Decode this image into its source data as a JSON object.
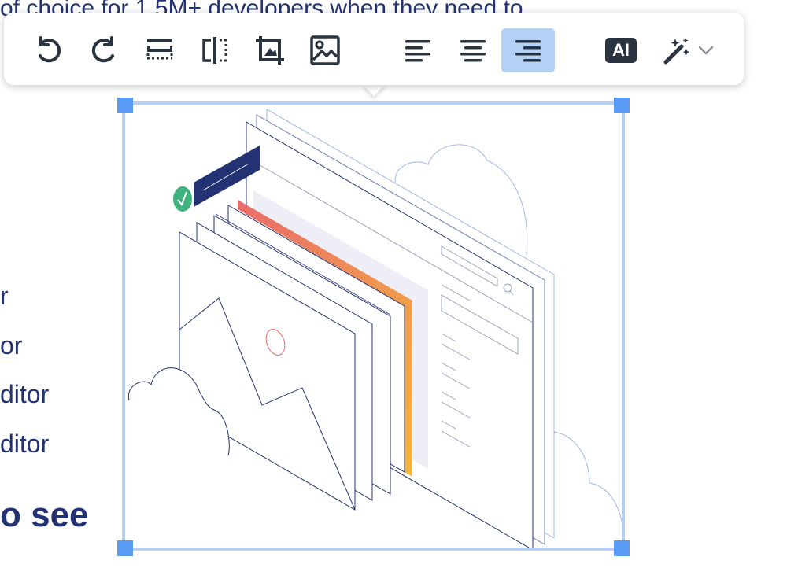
{
  "content": {
    "top_line": "of choice for 1.5M+ developers when they need to",
    "list_lines": [
      "r",
      "or",
      "ditor",
      "ditor"
    ],
    "bold_line": "o see"
  },
  "toolbar": {
    "buttons": [
      {
        "name": "undo",
        "icon": "undo-icon"
      },
      {
        "name": "redo",
        "icon": "redo-icon"
      },
      {
        "name": "image-inline",
        "icon": "image-inline-icon"
      },
      {
        "name": "image-side",
        "icon": "image-side-icon"
      },
      {
        "name": "crop",
        "icon": "crop-icon"
      },
      {
        "name": "replace-image",
        "icon": "image-icon"
      },
      {
        "name": "align-left",
        "icon": "align-left-icon"
      },
      {
        "name": "align-center",
        "icon": "align-center-icon"
      },
      {
        "name": "align-right",
        "icon": "align-right-icon",
        "active": true
      },
      {
        "name": "ai-assistant",
        "icon": "ai-icon"
      },
      {
        "name": "magic-dropdown",
        "icon": "magic-wand-icon"
      }
    ],
    "ai_label": "AI"
  },
  "colors": {
    "text": "#233272",
    "selection_border": "#b6d0f4",
    "handle": "#5a9bf5",
    "active_button": "#b4d1f5",
    "icon": "#2a3441",
    "illustration_navy": "#233272",
    "illustration_green": "#3fb27f",
    "illustration_gradient_start": "#e96b6b",
    "illustration_gradient_end": "#f5b53d"
  }
}
